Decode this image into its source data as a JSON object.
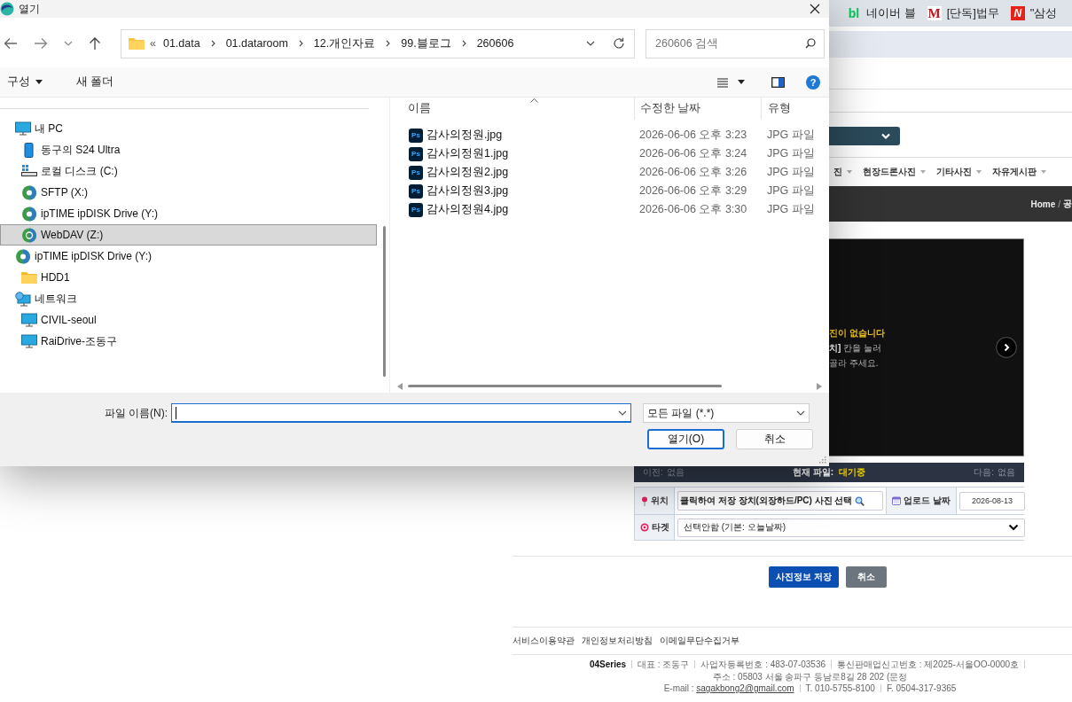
{
  "browser": {
    "bookmarks": [
      {
        "kind": "blog",
        "logo": "bl",
        "label": "네이버 블"
      },
      {
        "kind": "news",
        "logo": "M",
        "label": "[단독]법무"
      },
      {
        "kind": "portal",
        "logo": "N",
        "label": "\"삼성"
      }
    ]
  },
  "page": {
    "menu": [
      "진",
      "현장드론사진",
      "기타사진",
      "자유게시판"
    ],
    "breadcrumb": {
      "items": [
        "Home",
        "공"
      ],
      "separator": "/"
    },
    "viewer": {
      "title": "진이 없습니다",
      "lines": [
        "**치]** 칸을 눌러",
        "골라 주세요."
      ]
    },
    "status": {
      "prev_label": "이전:",
      "prev": "없음",
      "current_label": "현재 파일:",
      "current": "대기중",
      "next_label": "다음:",
      "next": "없음"
    },
    "form": {
      "location_label": "위치",
      "location_value": "클릭하여 저장 장치(외장하드/PC) 사진 선택",
      "date_label": "업로드 날짜",
      "date": "2026-08-13",
      "target_label": "타겟",
      "target": "선택안함 (기본: 오늘날짜)"
    },
    "buttons": [
      {
        "label": "사진정보 저장",
        "primary": true
      },
      {
        "label": "취소",
        "primary": false
      }
    ],
    "footer_links": [
      "서비스이용약관",
      "개인정보처리방침",
      "이메일무단수집거부"
    ],
    "footer_info": [
      [
        "04Series",
        "대표 : 조동구",
        "사업자등록번호 : 483-07-03536",
        "통신판매업신고번호 : 제2025-서울OO-0000호",
        "주소 : 05803 서울 송파구 동남로8길 28 202 (문정"
      ],
      [
        "E-mail : ",
        "sagakbong2@gmail.com",
        "T. 010-5755-8100",
        "F. 0504-317-9365"
      ]
    ]
  },
  "dialog": {
    "title": "열기",
    "address": {
      "prefix": "«",
      "crumbs": [
        "01.data",
        "01.dataroom",
        "12.개인자료",
        "99.블로그",
        "260606"
      ]
    },
    "search": {
      "placeholder": "260606 검색"
    },
    "toolbar": {
      "organize": "구성",
      "new_folder": "새 폴더",
      "help": "?"
    },
    "tree": [
      {
        "label": "내 PC",
        "kind": "pc",
        "selected": false,
        "children": [
          {
            "label": "동구의 S24 Ultra",
            "kind": "phone",
            "selected": false
          },
          {
            "label": "로컬 디스크 (C:)",
            "kind": "disk",
            "selected": false
          },
          {
            "label": "SFTP (X:)",
            "kind": "netdrive",
            "selected": false
          },
          {
            "label": "ipTIME ipDISK Drive (Y:)",
            "kind": "netdrive",
            "selected": false
          },
          {
            "label": "WebDAV (Z:)",
            "kind": "webdrive",
            "selected": true
          }
        ]
      },
      {
        "label": "ipTIME ipDISK Drive (Y:)",
        "kind": "netdrive",
        "selected": false,
        "children": [
          {
            "label": "HDD1",
            "kind": "folder",
            "selected": false
          }
        ]
      },
      {
        "label": "네트워크",
        "kind": "network",
        "selected": false,
        "children": [
          {
            "label": "CIVIL-seoul",
            "kind": "pc",
            "selected": false
          },
          {
            "label": "RaiDrive-조동구",
            "kind": "pc",
            "selected": false
          }
        ]
      }
    ],
    "files": {
      "columns": [
        "이름",
        "수정한 날짜",
        "유형"
      ],
      "rows": [
        {
          "badge": "Ps",
          "name": "감사의정원.jpg",
          "modified": "2026-06-06 오후 3:23",
          "type": "JPG 파일"
        },
        {
          "badge": "Ps",
          "name": "감사의정원1.jpg",
          "modified": "2026-06-06 오후 3:24",
          "type": "JPG 파일"
        },
        {
          "badge": "Ps",
          "name": "감사의정원2.jpg",
          "modified": "2026-06-06 오후 3:26",
          "type": "JPG 파일"
        },
        {
          "badge": "Ps",
          "name": "감사의정원3.jpg",
          "modified": "2026-06-06 오후 3:29",
          "type": "JPG 파일"
        },
        {
          "badge": "Ps",
          "name": "감사의정원4.jpg",
          "modified": "2026-06-06 오후 3:30",
          "type": "JPG 파일"
        }
      ]
    },
    "filename": {
      "label": "파일 이름(N):"
    },
    "filter": "모든 파일 (*.*)",
    "buttons": [
      {
        "label": "열기(O)",
        "primary": true
      },
      {
        "label": "취소",
        "primary": false
      }
    ]
  }
}
